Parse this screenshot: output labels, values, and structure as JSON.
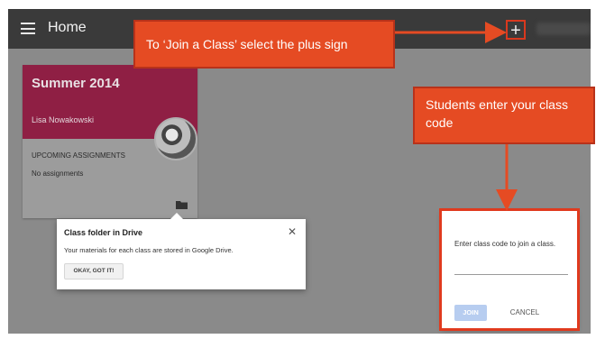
{
  "appbar": {
    "title": "Home",
    "plus_symbol": "+"
  },
  "class_card": {
    "title": "Summer 2014",
    "teacher": "Lisa Nowakowski",
    "section_label": "UPCOMING ASSIGNMENTS",
    "empty_text": "No assignments"
  },
  "tooltip": {
    "title": "Class folder in Drive",
    "close_symbol": "✕",
    "message": "Your materials for each class are stored in Google Drive.",
    "ok_label": "OKAY, GOT IT!"
  },
  "join_dialog": {
    "prompt": "Enter class code to join a class.",
    "join_label": "JOIN",
    "cancel_label": "CANCEL"
  },
  "annotations": {
    "plus_callout": "To ‘Join a Class’ select the plus sign",
    "code_callout": "Students enter your class code"
  },
  "colors": {
    "appbar": "#3a3a3a",
    "card_header": "#8f1f44",
    "callout": "#e54b23",
    "join_button": "#b7cdf0"
  },
  "icons": {
    "menu": "hamburger-menu-icon",
    "folder": "folder-icon",
    "close": "close-icon"
  }
}
